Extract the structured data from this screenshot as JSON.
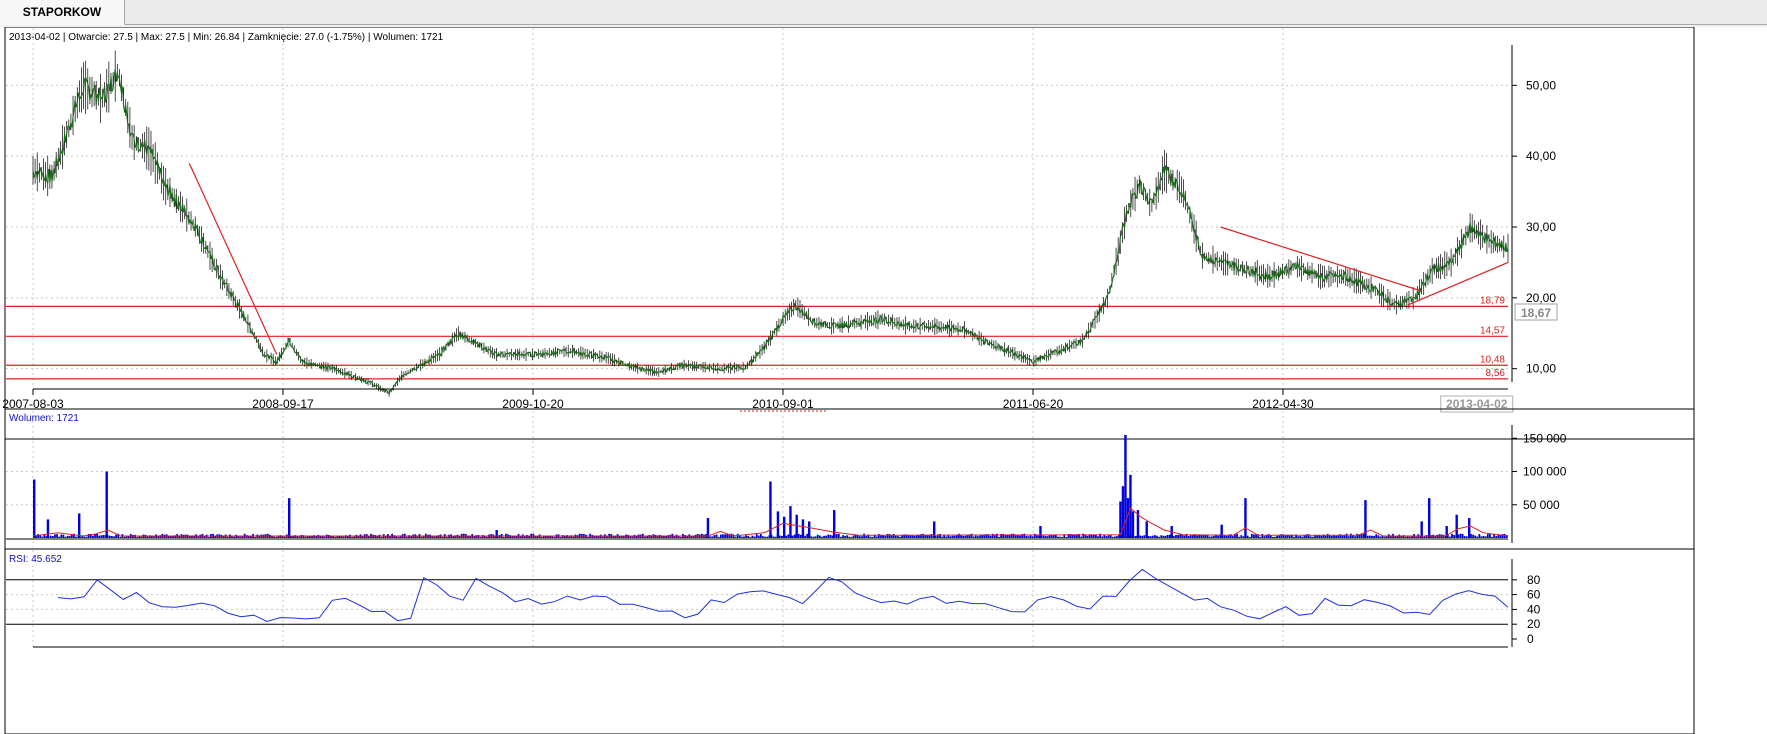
{
  "tab": {
    "label": "STAPORKOW"
  },
  "colors": {
    "candle": "#1a6b1a",
    "trend": "#e02020",
    "volume": "#0000e0",
    "volume_avg": "#e02020",
    "rsi": "#2030e0",
    "grid": "#c8c8c8",
    "panel_border": "#000000"
  },
  "chart_data": [
    {
      "type": "candlestick",
      "info": "2013-04-02 | Otwarcie: 27.5 | Max: 27.5 | Min: 26.84 | Zamknięcie: 27.0 (-1.75%)  | Wolumen: 1721",
      "x_ticks": [
        "2007-08-03",
        "2008-09-17",
        "2009-10-20",
        "2010-09-01",
        "2011-06-20",
        "2012-04-30"
      ],
      "x_marker": "2013-04-02",
      "y_ticks": [
        "10,00",
        "20,00",
        "30,00",
        "40,00",
        "50,00"
      ],
      "ylim": [
        6,
        54
      ],
      "current_value": "18,67",
      "levels": [
        {
          "label": "18,79",
          "value": 18.79
        },
        {
          "label": "14,57",
          "value": 14.57
        },
        {
          "label": "10,48",
          "value": 10.48
        },
        {
          "label": "8,56",
          "value": 8.56
        }
      ],
      "price_path": [
        [
          0,
          38
        ],
        [
          1.5,
          37
        ],
        [
          2.5,
          42
        ],
        [
          4,
          50
        ],
        [
          5.5,
          48
        ],
        [
          6.8,
          52
        ],
        [
          8,
          42
        ],
        [
          9.3,
          41
        ],
        [
          10.5,
          36
        ],
        [
          13,
          30
        ],
        [
          15,
          23
        ],
        [
          17,
          17
        ],
        [
          18.5,
          12
        ],
        [
          19.5,
          11
        ],
        [
          20.5,
          14
        ],
        [
          21.5,
          11
        ],
        [
          24,
          10
        ],
        [
          27,
          8
        ],
        [
          28.5,
          6.5
        ],
        [
          29.5,
          9
        ],
        [
          31,
          10.5
        ],
        [
          32.5,
          12
        ],
        [
          34,
          15
        ],
        [
          35,
          14
        ],
        [
          37,
          12
        ],
        [
          40,
          12
        ],
        [
          43,
          12.5
        ],
        [
          46,
          11.5
        ],
        [
          48,
          10.2
        ],
        [
          50,
          9.5
        ],
        [
          52,
          10.5
        ],
        [
          55,
          10
        ],
        [
          57,
          10.2
        ],
        [
          58.5,
          13
        ],
        [
          60,
          17
        ],
        [
          61,
          19
        ],
        [
          62.5,
          16.5
        ],
        [
          64,
          16
        ],
        [
          66,
          16.5
        ],
        [
          68,
          17
        ],
        [
          70,
          16
        ],
        [
          72,
          16
        ],
        [
          74.5,
          15.5
        ],
        [
          76,
          14
        ],
        [
          78,
          12.5
        ],
        [
          80,
          11
        ],
        [
          82,
          12.5
        ],
        [
          84,
          14
        ],
        [
          86,
          20
        ],
        [
          87.5,
          32
        ],
        [
          88.5,
          36
        ],
        [
          89.5,
          33
        ],
        [
          90.5,
          38
        ],
        [
          92,
          35
        ],
        [
          93.5,
          26
        ],
        [
          95,
          25
        ],
        [
          97,
          24
        ],
        [
          99,
          23
        ],
        [
          101,
          24.5
        ],
        [
          103,
          23
        ],
        [
          105,
          23
        ],
        [
          107,
          21.5
        ],
        [
          109,
          19
        ],
        [
          110.5,
          20
        ],
        [
          112,
          24
        ],
        [
          113.5,
          25
        ],
        [
          115,
          30
        ],
        [
          116.5,
          28
        ],
        [
          118,
          27
        ]
      ],
      "trendlines": [
        [
          [
            12.5,
            39
          ],
          [
            19.5,
            12
          ]
        ],
        [
          [
            95,
            30
          ],
          [
            111,
            21
          ]
        ],
        [
          [
            110,
            19
          ],
          [
            118,
            25
          ]
        ]
      ]
    },
    {
      "type": "bar",
      "title": "Wolumen: 1721",
      "y_ticks": [
        "50 000",
        "100 000",
        "150 000"
      ],
      "ylim": [
        0,
        170000
      ],
      "bars": [
        [
          0,
          88000
        ],
        [
          1.1,
          28000
        ],
        [
          3.6,
          37000
        ],
        [
          5.8,
          100000
        ],
        [
          20.4,
          60000
        ],
        [
          37,
          12000
        ],
        [
          53.9,
          30000
        ],
        [
          58.9,
          85000
        ],
        [
          59.5,
          40000
        ],
        [
          60,
          32000
        ],
        [
          60.5,
          48000
        ],
        [
          61,
          35000
        ],
        [
          61.5,
          28000
        ],
        [
          62,
          25000
        ],
        [
          64,
          42000
        ],
        [
          72,
          25000
        ],
        [
          80.5,
          18000
        ],
        [
          86.9,
          55000
        ],
        [
          87.1,
          78000
        ],
        [
          87.3,
          155000
        ],
        [
          87.5,
          60000
        ],
        [
          87.7,
          95000
        ],
        [
          87.9,
          40000
        ],
        [
          88.3,
          42000
        ],
        [
          89,
          25000
        ],
        [
          91,
          18000
        ],
        [
          95,
          20000
        ],
        [
          96.9,
          60000
        ],
        [
          106.5,
          57000
        ],
        [
          111,
          25000
        ],
        [
          111.6,
          60000
        ],
        [
          113,
          18000
        ],
        [
          113.8,
          35000
        ],
        [
          114.8,
          30000
        ]
      ],
      "avg_path": [
        [
          0,
          3000
        ],
        [
          2,
          8000
        ],
        [
          4,
          3000
        ],
        [
          5,
          6000
        ],
        [
          6,
          12000
        ],
        [
          7,
          3000
        ],
        [
          30,
          3000
        ],
        [
          54,
          3000
        ],
        [
          55,
          10000
        ],
        [
          56,
          3000
        ],
        [
          58.5,
          8000
        ],
        [
          60,
          22000
        ],
        [
          62,
          16000
        ],
        [
          64,
          9000
        ],
        [
          66,
          4000
        ],
        [
          87,
          5000
        ],
        [
          87.8,
          45000
        ],
        [
          88.6,
          32000
        ],
        [
          89.5,
          22000
        ],
        [
          90.5,
          12000
        ],
        [
          92,
          5000
        ],
        [
          96,
          4000
        ],
        [
          97,
          15000
        ],
        [
          98,
          4000
        ],
        [
          106,
          4000
        ],
        [
          107,
          12000
        ],
        [
          108,
          3000
        ],
        [
          113,
          3000
        ],
        [
          114,
          14000
        ],
        [
          115,
          18000
        ],
        [
          116,
          8000
        ],
        [
          118,
          3000
        ]
      ]
    },
    {
      "type": "line",
      "title": "RSI: 45.652",
      "y_ticks": [
        "0",
        "20",
        "40",
        "60",
        "80"
      ],
      "ylim": [
        0,
        100
      ],
      "bands": [
        80,
        20
      ],
      "values": [
        56,
        52,
        60,
        78,
        66,
        56,
        60,
        50,
        45,
        40,
        48,
        48,
        43,
        38,
        28,
        32,
        26,
        26,
        30,
        28,
        26,
        55,
        54,
        45,
        40,
        35,
        25,
        30,
        80,
        75,
        58,
        50,
        85,
        70,
        62,
        53,
        52,
        48,
        52,
        55,
        55,
        58,
        55,
        50,
        45,
        42,
        40,
        35,
        30,
        35,
        50,
        52,
        60,
        62,
        68,
        58,
        56,
        50,
        62,
        85,
        78,
        60,
        58,
        48,
        50,
        50,
        52,
        58,
        50,
        48,
        50,
        48,
        40,
        40,
        35,
        52,
        60,
        50,
        45,
        42,
        55,
        60,
        78,
        92,
        85,
        70,
        62,
        55,
        52,
        45,
        40,
        28,
        30,
        35,
        42,
        35,
        32,
        55,
        48,
        42,
        55,
        50,
        42,
        38,
        35,
        32,
        55,
        58,
        66,
        62,
        55,
        45
      ]
    }
  ]
}
